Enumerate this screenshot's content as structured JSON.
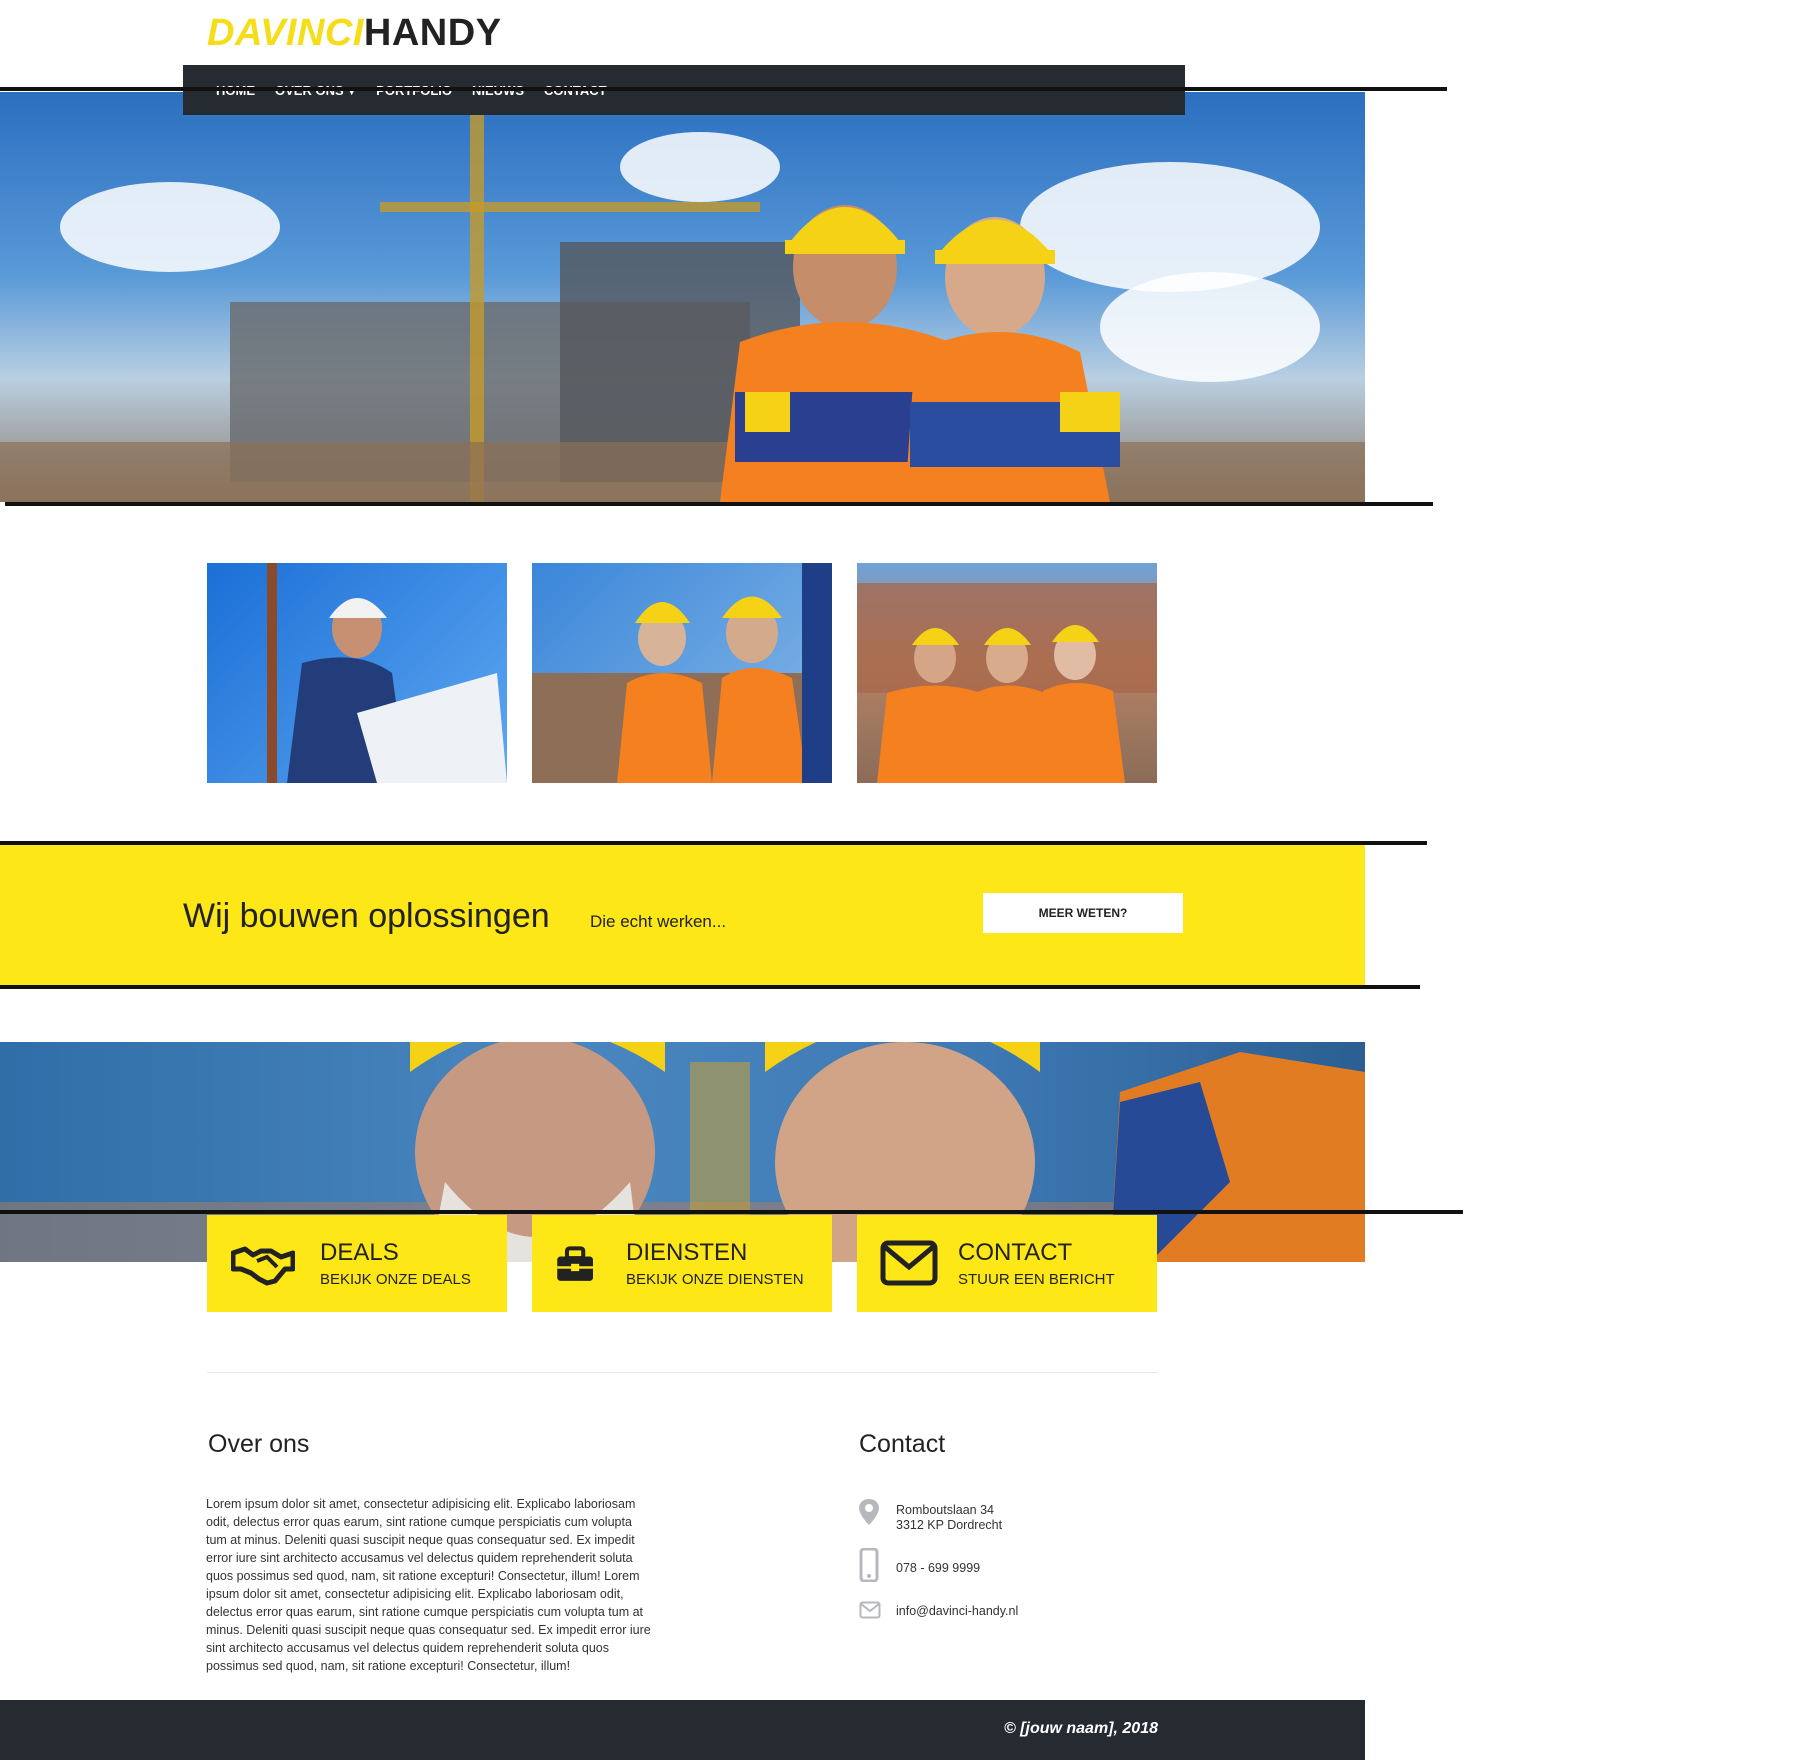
{
  "logo": {
    "part1": "DAVINCI",
    "part2": "HANDY"
  },
  "nav": {
    "items": [
      {
        "label": "HOME"
      },
      {
        "label": "OVER ONS"
      },
      {
        "label": "PORTFOLIO"
      },
      {
        "label": "NIEUWS"
      },
      {
        "label": "CONTACT"
      }
    ]
  },
  "band": {
    "title": "Wij bouwen oplossingen",
    "subtitle": "Die echt werken...",
    "button": "MEER WETEN?"
  },
  "features": [
    {
      "title": "DEALS",
      "subtitle": "BEKIJK ONZE DEALS",
      "icon": "handshake-icon"
    },
    {
      "title": "DIENSTEN",
      "subtitle": "BEKIJK ONZE DIENSTEN",
      "icon": "toolbox-icon"
    },
    {
      "title": "CONTACT",
      "subtitle": "STUUR EEN BERICHT",
      "icon": "envelope-icon"
    }
  ],
  "about": {
    "heading": "Over ons",
    "text": "Lorem ipsum dolor sit amet, consectetur adipisicing elit. Explicabo laboriosam odit, delectus error quas earum, sint ratione cumque perspiciatis cum volupta tum at minus. Deleniti quasi suscipit neque quas consequatur sed. Ex impedit error iure sint architecto accusamus vel delectus quidem reprehenderit soluta quos possimus sed quod, nam, sit ratione excepturi! Consectetur, illum! Lorem ipsum dolor sit amet, consectetur adipisicing elit. Explicabo laboriosam odit, delectus error quas earum, sint ratione cumque perspiciatis cum volupta tum at minus. Deleniti quasi suscipit neque quas consequatur sed. Ex impedit error iure sint architecto accusamus vel delectus quidem reprehenderit soluta quos possimus sed quod, nam, sit ratione excepturi! Consectetur, illum!"
  },
  "contact": {
    "heading": "Contact",
    "address_line1": "Romboutslaan 34",
    "address_line2": "3312 KP Dordrecht",
    "phone": "078 - 699 9999",
    "email": "info@davinci-handy.nl"
  },
  "footer": {
    "text": "© [jouw naam], 2018"
  },
  "colors": {
    "accent": "#fde716",
    "dark": "#262a31"
  }
}
